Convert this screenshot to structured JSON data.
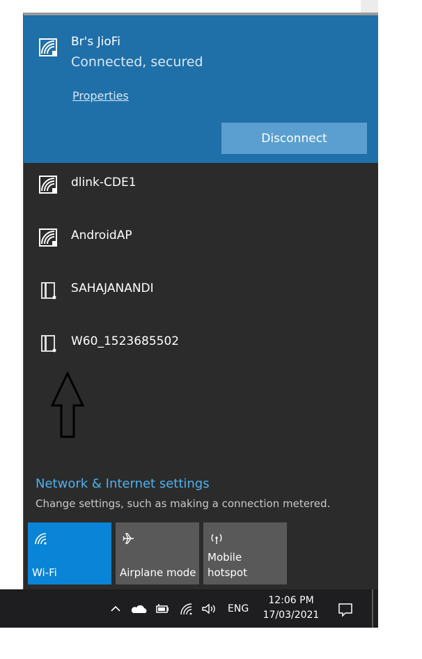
{
  "connected_network": {
    "name": "Br's JioFi",
    "status": "Connected, secured",
    "properties_label": "Properties",
    "disconnect_label": "Disconnect",
    "icon": "wifi-secured-icon"
  },
  "networks": [
    {
      "name": "dlink-CDE1",
      "icon": "wifi-secured-icon"
    },
    {
      "name": "AndroidAP",
      "icon": "wifi-secured-icon"
    },
    {
      "name": "SAHAJANANDI",
      "icon": "wifi-weak-icon"
    },
    {
      "name": "W60_1523685502",
      "icon": "wifi-weak-icon"
    }
  ],
  "annotation": {
    "icon": "up-arrow-outline"
  },
  "settings": {
    "link_label": "Network & Internet settings",
    "description": "Change settings, such as making a connection metered."
  },
  "quick_actions": [
    {
      "label": "Wi-Fi",
      "icon": "wifi-icon",
      "active": true
    },
    {
      "label": "Airplane mode",
      "icon": "airplane-icon",
      "active": false
    },
    {
      "label_line1": "Mobile",
      "label_line2": "hotspot",
      "icon": "hotspot-icon",
      "active": false
    }
  ],
  "taskbar": {
    "language": "ENG",
    "time": "12:06 PM",
    "date": "17/03/2021",
    "icons": [
      "chevron-up-icon",
      "cloud-icon",
      "battery-icon",
      "wifi-icon",
      "volume-icon",
      "notification-icon"
    ]
  },
  "colors": {
    "flyout_bg": "#2b2b2b",
    "connected_bg": "#1f6fa9",
    "disconnect_bg": "#5a9fd0",
    "accent_link": "#4fb2ef",
    "tile_active": "#0a84d6",
    "tile_inactive": "#595959",
    "taskbar_bg": "#1e1e20"
  }
}
